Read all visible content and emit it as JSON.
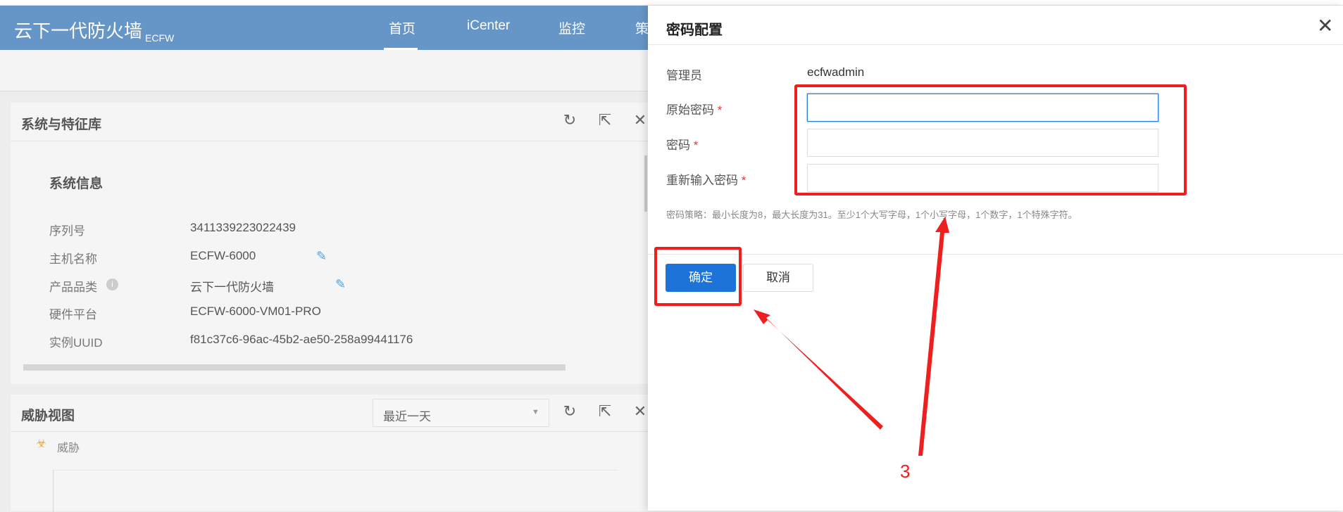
{
  "header": {
    "brand": "云下一代防火墙",
    "brand_sub": "ECFW",
    "nav": [
      "首页",
      "iCenter",
      "监控",
      "策"
    ]
  },
  "panel1": {
    "title": "系统与特征库",
    "section": "系统信息",
    "rows": [
      {
        "label": "序列号",
        "value": "3411339223022439"
      },
      {
        "label": "主机名称",
        "value": "ECFW-6000"
      },
      {
        "label": "产品品类",
        "value": "云下一代防火墙"
      },
      {
        "label": "硬件平台",
        "value": "ECFW-6000-VM01-PRO"
      },
      {
        "label": "实例UUID",
        "value": "f81c37c6-96ac-45b2-ae50-258a99441176"
      }
    ]
  },
  "panel2": {
    "title": "威胁视图",
    "range_select": "最近一天",
    "legend": "威胁"
  },
  "modal": {
    "title": "密码配置",
    "admin_label": "管理员",
    "admin_value": "ecfwadmin",
    "fields": [
      {
        "label": "原始密码",
        "value": ""
      },
      {
        "label": "密码",
        "value": ""
      },
      {
        "label": "重新输入密码",
        "value": ""
      }
    ],
    "required_mark": "*",
    "policy": "密码策略：最小长度为8，最大长度为31。至少1个大写字母，1个小写字母，1个数字，1个特殊字符。",
    "ok": "确定",
    "cancel": "取消"
  },
  "annotation": {
    "step": "3",
    "color": "#f01f1f"
  }
}
